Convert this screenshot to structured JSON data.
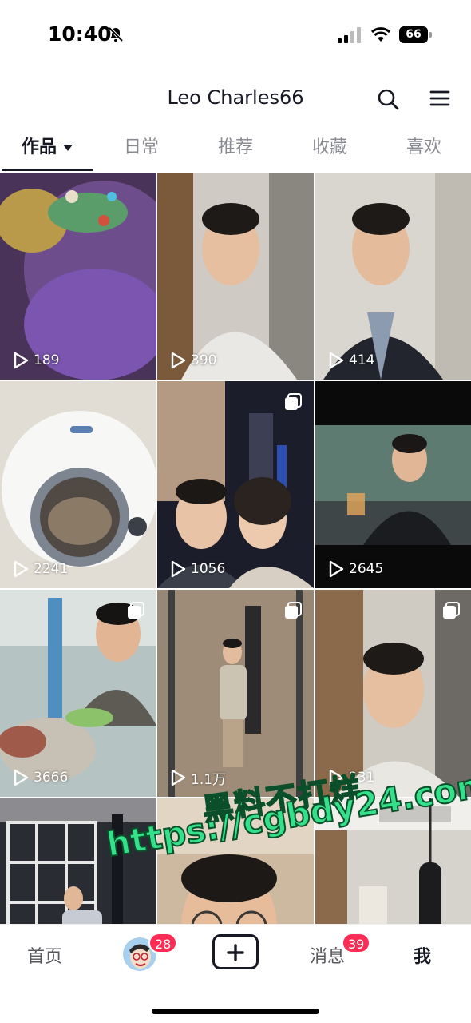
{
  "status_bar": {
    "time": "10:40",
    "battery": "66",
    "icons": [
      "mute-icon",
      "signal-icon",
      "wifi-icon",
      "battery-icon"
    ]
  },
  "header": {
    "title": "Leo Charles66",
    "icons": [
      "search-icon",
      "menu-icon"
    ]
  },
  "tabs": [
    {
      "label": "作品",
      "active": true
    },
    {
      "label": "日常",
      "active": false
    },
    {
      "label": "推荐",
      "active": false
    },
    {
      "label": "收藏",
      "active": false
    },
    {
      "label": "喜欢",
      "active": false
    }
  ],
  "videos": [
    {
      "views": "189",
      "multi": false
    },
    {
      "views": "390",
      "multi": false
    },
    {
      "views": "414",
      "multi": false
    },
    {
      "views": "2241",
      "multi": false
    },
    {
      "views": "1056",
      "multi": true
    },
    {
      "views": "2645",
      "multi": false
    },
    {
      "views": "3666",
      "multi": true
    },
    {
      "views": "1.1万",
      "multi": true
    },
    {
      "views": "231",
      "multi": true
    },
    {
      "views": "",
      "multi": false
    },
    {
      "views": "",
      "multi": false
    },
    {
      "views": "",
      "multi": false
    }
  ],
  "watermark": {
    "line1": "黑料不打烊",
    "line2": "https://cgbdy24.com"
  },
  "bottom_nav": {
    "home": "首页",
    "friends_badge": "28",
    "messages": "消息",
    "messages_badge": "39",
    "me": "我"
  },
  "colors": {
    "accent_badge": "#fe2c55",
    "text_primary": "#161823",
    "text_secondary": "#8a8b91",
    "watermark": "#34e08a"
  }
}
